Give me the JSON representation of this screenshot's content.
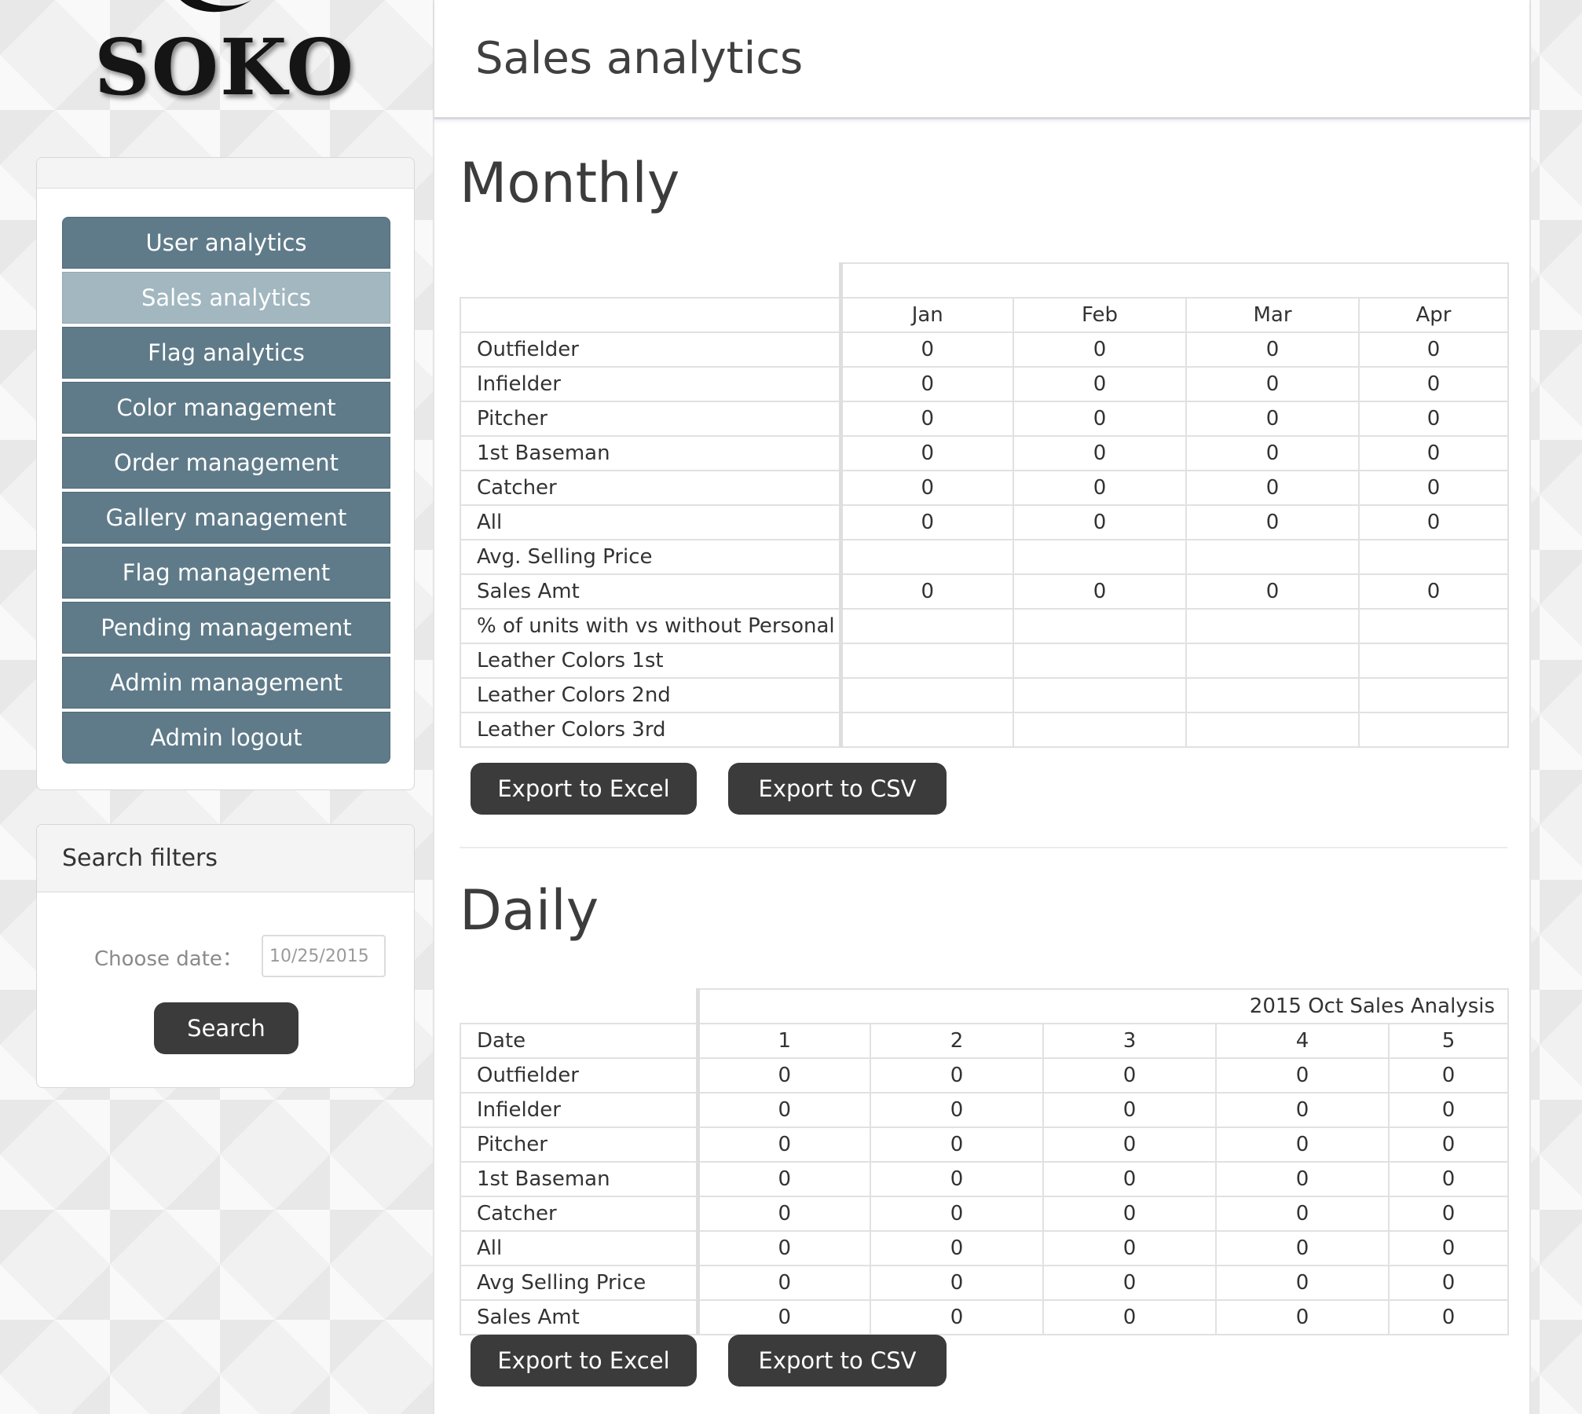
{
  "logo": {
    "text": "SOKO"
  },
  "nav": {
    "items": [
      {
        "label": "User analytics",
        "active": false
      },
      {
        "label": "Sales analytics",
        "active": true
      },
      {
        "label": "Flag analytics",
        "active": false
      },
      {
        "label": "Color management",
        "active": false
      },
      {
        "label": "Order management",
        "active": false
      },
      {
        "label": "Gallery management",
        "active": false
      },
      {
        "label": "Flag management",
        "active": false
      },
      {
        "label": "Pending management",
        "active": false
      },
      {
        "label": "Admin management",
        "active": false
      },
      {
        "label": "Admin logout",
        "active": false
      }
    ]
  },
  "search": {
    "title": "Search filters",
    "date_label": "Choose date：",
    "date_value": "10/25/2015",
    "button": "Search"
  },
  "page": {
    "title": "Sales analytics"
  },
  "monthly": {
    "title": "Monthly",
    "columns": [
      "Jan",
      "Feb",
      "Mar",
      "Apr"
    ],
    "rows": [
      {
        "label": "Outfielder",
        "values": [
          "0",
          "0",
          "0",
          "0"
        ]
      },
      {
        "label": "Infielder",
        "values": [
          "0",
          "0",
          "0",
          "0"
        ]
      },
      {
        "label": "Pitcher",
        "values": [
          "0",
          "0",
          "0",
          "0"
        ]
      },
      {
        "label": "1st Baseman",
        "values": [
          "0",
          "0",
          "0",
          "0"
        ]
      },
      {
        "label": "Catcher",
        "values": [
          "0",
          "0",
          "0",
          "0"
        ]
      },
      {
        "label": "All",
        "values": [
          "0",
          "0",
          "0",
          "0"
        ]
      },
      {
        "label": "Avg. Selling Price",
        "values": [
          "",
          "",
          "",
          ""
        ]
      },
      {
        "label": "Sales Amt",
        "values": [
          "0",
          "0",
          "0",
          "0"
        ]
      },
      {
        "label": "% of units with vs without Personal Emb",
        "values": [
          "",
          "",
          "",
          ""
        ]
      },
      {
        "label": "Leather Colors 1st",
        "values": [
          "",
          "",
          "",
          ""
        ]
      },
      {
        "label": "Leather Colors 2nd",
        "values": [
          "",
          "",
          "",
          ""
        ]
      },
      {
        "label": "Leather Colors 3rd",
        "values": [
          "",
          "",
          "",
          ""
        ]
      }
    ],
    "export_excel": "Export to Excel",
    "export_csv": "Export to CSV"
  },
  "daily": {
    "title": "Daily",
    "caption": "2015 Oct Sales Analysis",
    "header_label": "Date",
    "columns": [
      "1",
      "2",
      "3",
      "4",
      "5"
    ],
    "rows": [
      {
        "label": "Outfielder",
        "values": [
          "0",
          "0",
          "0",
          "0",
          "0"
        ]
      },
      {
        "label": "Infielder",
        "values": [
          "0",
          "0",
          "0",
          "0",
          "0"
        ]
      },
      {
        "label": "Pitcher",
        "values": [
          "0",
          "0",
          "0",
          "0",
          "0"
        ]
      },
      {
        "label": "1st Baseman",
        "values": [
          "0",
          "0",
          "0",
          "0",
          "0"
        ]
      },
      {
        "label": "Catcher",
        "values": [
          "0",
          "0",
          "0",
          "0",
          "0"
        ]
      },
      {
        "label": "All",
        "values": [
          "0",
          "0",
          "0",
          "0",
          "0"
        ]
      },
      {
        "label": "Avg Selling Price",
        "values": [
          "0",
          "0",
          "0",
          "0",
          "0"
        ]
      },
      {
        "label": "Sales Amt",
        "values": [
          "0",
          "0",
          "0",
          "0",
          "0"
        ]
      }
    ],
    "export_excel": "Export to Excel",
    "export_csv": "Export to CSV"
  },
  "colors": {
    "nav_item": "#5f7b89",
    "nav_item_active": "#a2b7c0",
    "dark_button": "#3b3b3b"
  }
}
